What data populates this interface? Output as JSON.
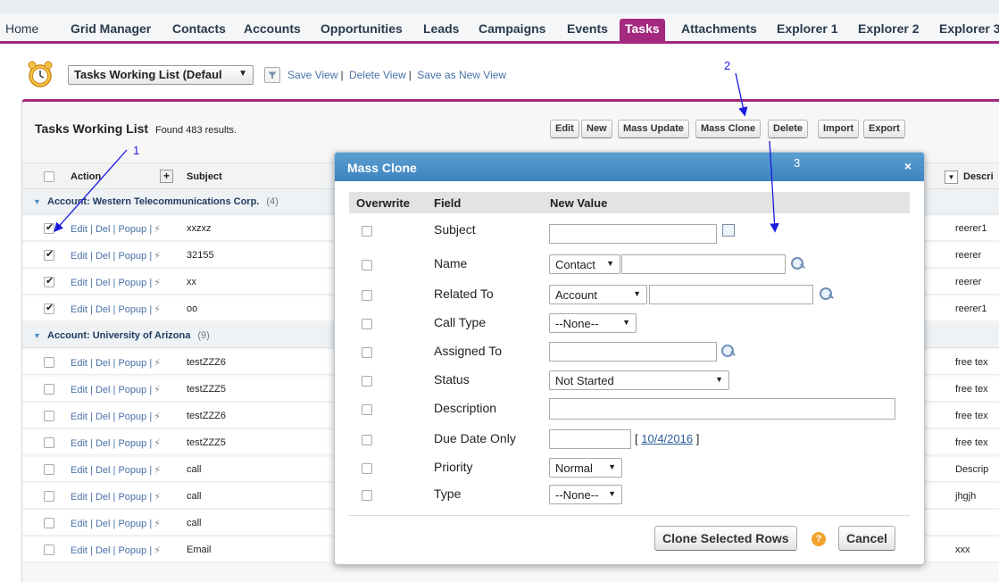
{
  "tabs": [
    {
      "label": "Home",
      "x_hint": "home"
    },
    {
      "label": "Grid Manager"
    },
    {
      "label": "Contacts"
    },
    {
      "label": "Accounts"
    },
    {
      "label": "Opportunities"
    },
    {
      "label": "Leads"
    },
    {
      "label": "Campaigns"
    },
    {
      "label": "Events"
    },
    {
      "label": "Tasks",
      "active": true
    },
    {
      "label": "Attachments"
    },
    {
      "label": "Explorer 1"
    },
    {
      "label": "Explorer 2"
    },
    {
      "label": "Explorer 3"
    }
  ],
  "viewbar": {
    "selected_view": "Tasks Working List (Defaul",
    "save_view": "Save View",
    "delete_view": "Delete View",
    "save_as_new": "Save as New View"
  },
  "list": {
    "title": "Tasks Working List",
    "count_text": "Found 483 results.",
    "buttons": [
      "Edit",
      "New",
      "Mass Update",
      "Mass Clone",
      "Delete",
      "Import",
      "Export"
    ],
    "headers": {
      "action": "Action",
      "subject": "Subject",
      "description": "Descri"
    },
    "groups": [
      {
        "label": "Account: Western Telecommunications Corp.",
        "count": "(4)",
        "rows": [
          {
            "checked": true,
            "subject": "xxzxz",
            "desc": "reerer1"
          },
          {
            "checked": true,
            "subject": "32155",
            "desc": "reerer"
          },
          {
            "checked": true,
            "subject": "xx",
            "desc": "reerer"
          },
          {
            "checked": true,
            "subject": "oo",
            "desc": "reerer1"
          }
        ]
      },
      {
        "label": "Account: University of Arizona",
        "count": "(9)",
        "rows": [
          {
            "checked": false,
            "subject": "testZZZ6",
            "desc": "free tex"
          },
          {
            "checked": false,
            "subject": "testZZZ5",
            "desc": "free tex"
          },
          {
            "checked": false,
            "subject": "testZZZ6",
            "desc": "free tex"
          },
          {
            "checked": false,
            "subject": "testZZZ5",
            "desc": "free tex"
          },
          {
            "checked": false,
            "subject": "call",
            "desc": "Descrip"
          },
          {
            "checked": false,
            "subject": "call",
            "desc": "jhgjh"
          },
          {
            "checked": false,
            "subject": "call",
            "desc": ""
          },
          {
            "checked": false,
            "subject": "Email",
            "desc": "xxx"
          }
        ]
      }
    ],
    "row_actions": {
      "edit": "Edit",
      "del": "Del",
      "popup": "Popup",
      "sep": "|",
      "bolt": "⚡"
    }
  },
  "modal": {
    "title": "Mass Clone",
    "close": "×",
    "col_overwrite": "Overwrite",
    "col_field": "Field",
    "col_new_value": "New Value",
    "fields": {
      "subject": "Subject",
      "name": "Name",
      "related_to": "Related To",
      "call_type": "Call Type",
      "assigned_to": "Assigned To",
      "status": "Status",
      "description": "Description",
      "due_date": "Due Date Only",
      "priority": "Priority",
      "type": "Type"
    },
    "values": {
      "name_type": "Contact",
      "related_type": "Account",
      "call_type": "--None--",
      "status": "Not Started",
      "priority": "Normal",
      "type": "--None--",
      "due_date_link": "10/4/2016",
      "bracket_open": "[",
      "bracket_close": "]"
    },
    "clone_button": "Clone Selected Rows",
    "help": "?",
    "cancel_button": "Cancel"
  },
  "annotations": {
    "n1": "1",
    "n2": "2",
    "n3": "3",
    "color": "#1a1ae0"
  },
  "colors": {
    "brand": "#a3287e",
    "modal_header": "#3d83bf",
    "link": "#4a72a8"
  }
}
